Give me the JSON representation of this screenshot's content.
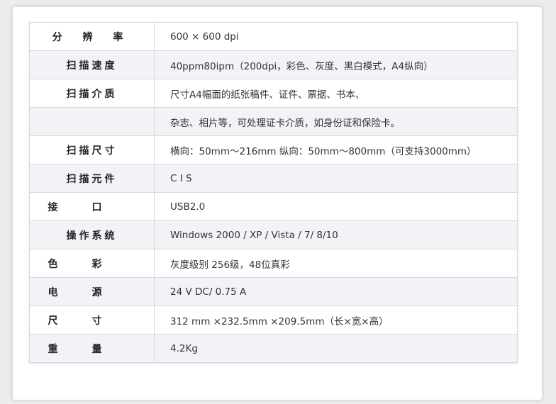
{
  "specs": [
    {
      "label": "分 辨 率",
      "value": "600 × 600 dpi",
      "spacing": "3"
    },
    {
      "label": "扫描速度",
      "value": "40ppm80ipm（200dpi，彩色、灰度、黑白模式，A4纵向）",
      "spacing": "4"
    },
    {
      "label": "扫描介质",
      "value": "尺寸A4幅面的纸张稿件、证件、票据、书本、",
      "spacing": "4"
    },
    {
      "label": "",
      "value": "杂志、相片等，可处理证卡介质，如身份证和保险卡。",
      "spacing": "4"
    },
    {
      "label": "扫描尺寸",
      "value": "横向：50mm～216mm 纵向：50mm～800mm（可支持3000mm）",
      "spacing": "4"
    },
    {
      "label": "扫描元件",
      "value": "C I S",
      "spacing": "4"
    },
    {
      "label": "接口",
      "value": "USB2.0",
      "spacing": "2"
    },
    {
      "label": "操作系统",
      "value": "Windows 2000 / XP / Vista / 7/ 8/10",
      "spacing": "4"
    },
    {
      "label": "色彩",
      "value": "灰度级别 256级，48位真彩",
      "spacing": "2"
    },
    {
      "label": "电源",
      "value": "24 V DC/ 0.75 A",
      "spacing": "2"
    },
    {
      "label": "尺寸",
      "value": "312 mm ×232.5mm ×209.5mm（长×宽×高）",
      "spacing": "2"
    },
    {
      "label": "重量",
      "value": "4.2Kg",
      "spacing": "2"
    }
  ]
}
